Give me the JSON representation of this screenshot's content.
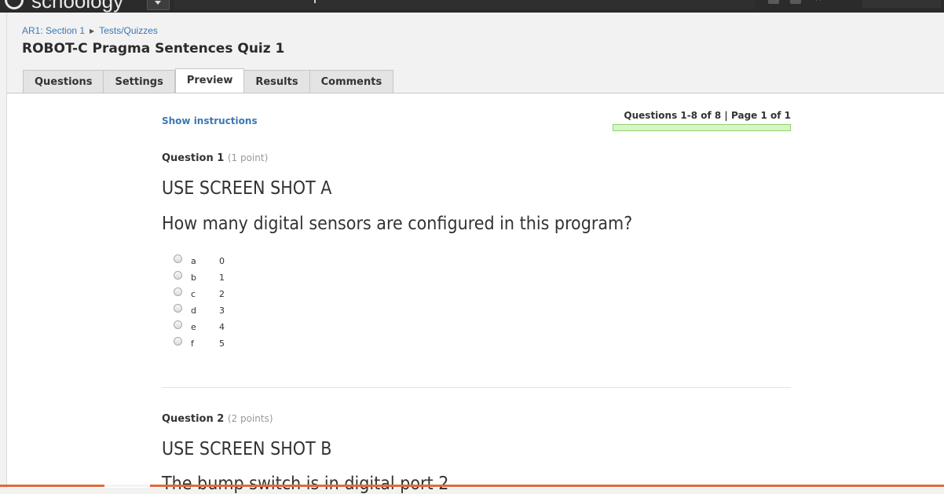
{
  "app": {
    "logo_text": "schoology"
  },
  "breadcrumb": {
    "course": "AR1: Section 1",
    "section": "Tests/Quizzes"
  },
  "page": {
    "title": "ROBOT-C Pragma Sentences Quiz 1"
  },
  "tabs": [
    {
      "label": "Questions"
    },
    {
      "label": "Settings"
    },
    {
      "label": "Preview",
      "active": true
    },
    {
      "label": "Results"
    },
    {
      "label": "Comments"
    }
  ],
  "instructions_link": "Show instructions",
  "pager": {
    "text": "Questions 1-8 of 8 | Page 1 of 1",
    "progress": 1.0
  },
  "questions": [
    {
      "label": "Question 1",
      "points": "(1 point)",
      "line1": "USE SCREEN SHOT A",
      "line2": "How many digital sensors are configured in this program?",
      "options": [
        {
          "letter": "a",
          "value": "0"
        },
        {
          "letter": "b",
          "value": "1"
        },
        {
          "letter": "c",
          "value": "2"
        },
        {
          "letter": "d",
          "value": "3"
        },
        {
          "letter": "e",
          "value": "4"
        },
        {
          "letter": "f",
          "value": "5"
        }
      ]
    },
    {
      "label": "Question 2",
      "points": "(2 points)",
      "line1": "USE SCREEN SHOT B",
      "line2": "The bump switch is in digital port 2"
    }
  ],
  "colors": {
    "link": "#3a78b5",
    "progress_fill": "#d8f5c8",
    "progress_border": "#8fd36c",
    "topbar": "#2b2b2b"
  },
  "icons": [
    "schoology-logo-icon",
    "dropdown-chevron-icon",
    "star-icon",
    "radio-button-icon"
  ]
}
